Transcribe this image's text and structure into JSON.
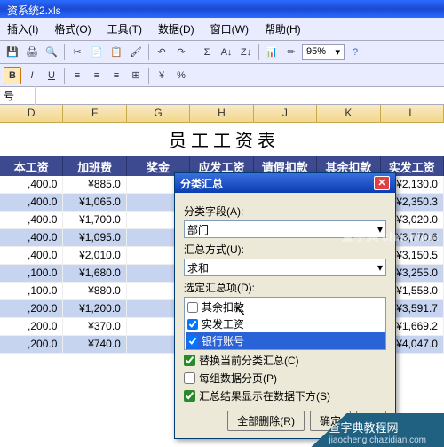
{
  "titlebar": "资系统2.xls",
  "menu": {
    "m0": "插入(I)",
    "m1": "格式(O)",
    "m2": "工具(T)",
    "m3": "数据(D)",
    "m4": "窗口(W)",
    "m5": "帮助(H)"
  },
  "toolbar": {
    "zoom": "95%"
  },
  "formula_bar": "号",
  "columns": {
    "c0": "D",
    "c1": "F",
    "c2": "G",
    "c3": "H",
    "c4": "J",
    "c5": "K",
    "c6": "L"
  },
  "sheet_title": "员 工 工 资 表",
  "headers": {
    "h0": "本工资",
    "h1": "加班费",
    "h2": "奖金",
    "h3": "应发工资",
    "h4": "请假扣款",
    "h5": "其余扣款",
    "h6": "实发工资"
  },
  "rows": [
    {
      "c0": ",400.0",
      "c1": "¥885.0",
      "c6": "¥2,130.0"
    },
    {
      "c0": ",400.0",
      "c1": "¥1,065.0",
      "c6": "¥2,350.3"
    },
    {
      "c0": ",400.0",
      "c1": "¥1,700.0",
      "c6": "¥3,020.0"
    },
    {
      "c0": ",400.0",
      "c1": "¥1,095.0",
      "c6": "¥3,770.6"
    },
    {
      "c0": ",400.0",
      "c1": "¥2,010.0",
      "c6": "¥3,150.5"
    },
    {
      "c0": ",100.0",
      "c1": "¥1,680.0",
      "c6": "¥3,255.0"
    },
    {
      "c0": ",100.0",
      "c1": "¥880.0",
      "c6": "¥1,558.0"
    },
    {
      "c0": ",200.0",
      "c1": "¥1,200.0",
      "c6": "¥3,591.7"
    },
    {
      "c0": ",200.0",
      "c1": "¥370.0",
      "c6": "¥1,669.2"
    },
    {
      "c0": ",200.0",
      "c1": "¥740.0",
      "c6": "¥4,047.0"
    }
  ],
  "dialog": {
    "title": "分类汇总",
    "field_label": "分类字段(A):",
    "field_value": "部门",
    "func_label": "汇总方式(U):",
    "func_value": "求和",
    "items_label": "选定汇总项(D):",
    "items": [
      {
        "label": "其余扣款",
        "checked": false,
        "sel": false
      },
      {
        "label": "实发工资",
        "checked": true,
        "sel": false
      },
      {
        "label": "银行账号",
        "checked": true,
        "sel": true
      }
    ],
    "opt1": "替换当前分类汇总(C)",
    "opt2": "每组数据分页(P)",
    "opt3": "汇总结果显示在数据下方(S)",
    "btn_removeall": "全部删除(R)",
    "btn_ok": "确定",
    "btn_cancel": "取"
  },
  "watermark1": "查字典\nchazidian",
  "watermark2": {
    "top": "查字典教程网",
    "sub": "jiaocheng chazidian.com"
  },
  "chart_data": {
    "type": "table",
    "title": "员工工资表",
    "columns": [
      "本工资(partial)",
      "加班费",
      "奖金",
      "应发工资",
      "请假扣款",
      "其余扣款",
      "实发工资"
    ],
    "note": "奖金/应发工资/请假扣款/其余扣款 columns obscured by dialog",
    "rows": [
      [
        "_,400.0",
        "¥885.0",
        null,
        null,
        null,
        null,
        "¥2,130.0"
      ],
      [
        "_,400.0",
        "¥1,065.0",
        null,
        null,
        null,
        null,
        "¥2,350.3"
      ],
      [
        "_,400.0",
        "¥1,700.0",
        null,
        null,
        null,
        null,
        "¥3,020.0"
      ],
      [
        "_,400.0",
        "¥1,095.0",
        null,
        null,
        null,
        null,
        "¥3,770.6"
      ],
      [
        "_,400.0",
        "¥2,010.0",
        null,
        null,
        null,
        null,
        "¥3,150.5"
      ],
      [
        "_,100.0",
        "¥1,680.0",
        null,
        null,
        null,
        null,
        "¥3,255.0"
      ],
      [
        "_,100.0",
        "¥880.0",
        null,
        null,
        null,
        null,
        "¥1,558.0"
      ],
      [
        "_,200.0",
        "¥1,200.0",
        null,
        null,
        null,
        null,
        "¥3,591.7"
      ],
      [
        "_,200.0",
        "¥370.0",
        null,
        null,
        null,
        null,
        "¥1,669.2"
      ],
      [
        "_,200.0",
        "¥740.0",
        null,
        null,
        null,
        null,
        "¥4,047.0"
      ]
    ]
  }
}
